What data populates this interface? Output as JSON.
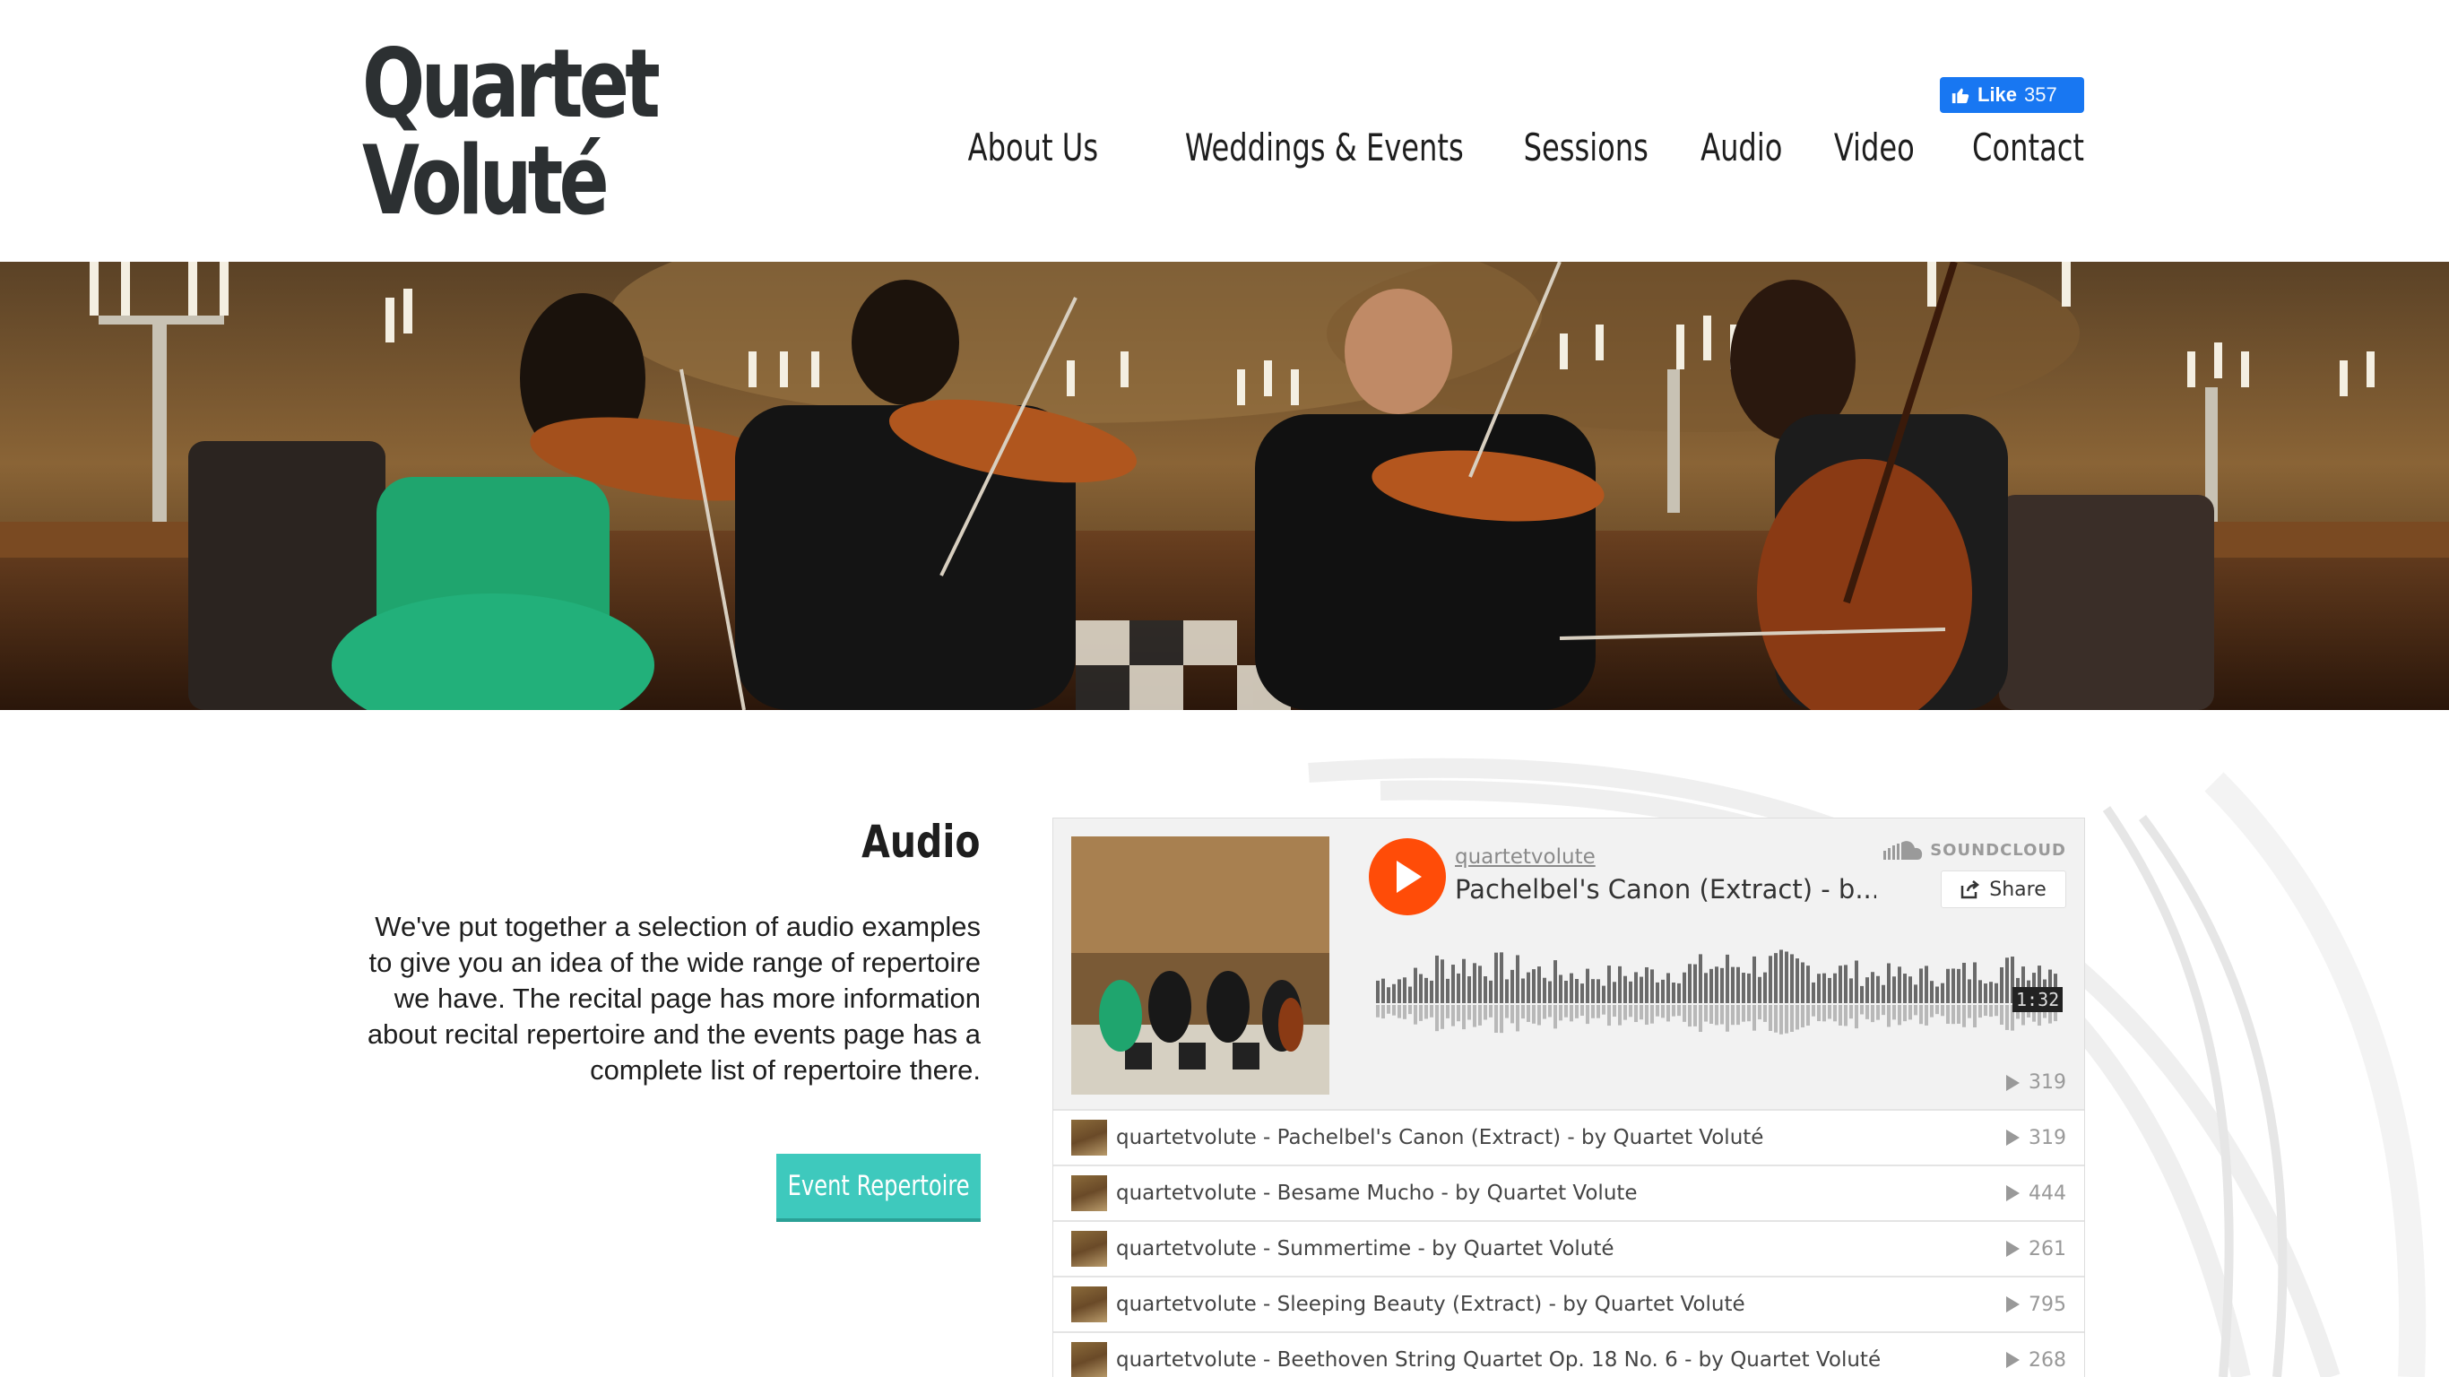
{
  "header": {
    "logo_line1": "Quartet",
    "logo_line2": "Voluté",
    "fb_like_label": "Like",
    "fb_like_count": "357",
    "nav": [
      "About Us",
      "Weddings & Events",
      "Sessions",
      "Audio",
      "Video",
      "Contact"
    ]
  },
  "main": {
    "audio_title": "Audio",
    "audio_description": "We've put together a selection of audio examples to give you an idea of the wide range of repertoire we have. The recital page has more information about recital repertoire and the events page has a complete list of repertoire there.",
    "event_repertoire_button": "Event Repertoire"
  },
  "soundcloud": {
    "username": "quartetvolute",
    "current_track_title": "Pachelbel's Canon (Extract) - b...",
    "logo_text": "SOUNDCLOUD",
    "share_label": "Share",
    "duration": "1:32",
    "current_plays": "319",
    "accent_color": "#ff4c08",
    "tracks": [
      {
        "title": "quartetvolute - Pachelbel's Canon (Extract) - by Quartet Voluté",
        "plays": "319"
      },
      {
        "title": "quartetvolute - Besame Mucho - by Quartet Volute",
        "plays": "444"
      },
      {
        "title": "quartetvolute - Summertime - by Quartet Voluté",
        "plays": "261"
      },
      {
        "title": "quartetvolute - Sleeping Beauty (Extract) - by Quartet Voluté",
        "plays": "795"
      },
      {
        "title": "quartetvolute - Beethoven String Quartet Op. 18 No. 6 - by Quartet Voluté",
        "plays": "268"
      }
    ]
  },
  "colors": {
    "button_teal": "#3ec9bd",
    "facebook_blue": "#1877f2",
    "logo_dark": "#2c3032"
  }
}
